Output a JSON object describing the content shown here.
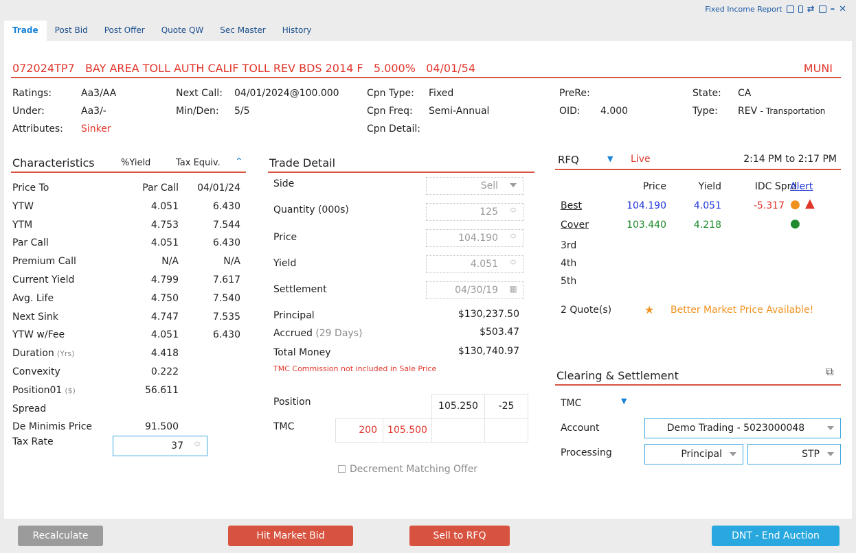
{
  "window": {
    "report_label": "Fixed Income Report",
    "tabs": [
      "Trade",
      "Post Bid",
      "Post Offer",
      "Quote QW",
      "Sec Master",
      "History"
    ]
  },
  "security": {
    "header": "072024TP7   BAY AREA TOLL AUTH CALIF TOLL REV BDS 2014 F   5.000%   04/01/54",
    "sector": "MUNI"
  },
  "info": {
    "ratings_label": "Ratings:",
    "ratings_value": "Aa3/AA",
    "under_label": "Under:",
    "under_value": "Aa3/-",
    "attributes_label": "Attributes:",
    "attributes_value": "Sinker",
    "next_call_label": "Next Call:",
    "next_call_value": "04/01/2024@100.000",
    "min_den_label": "Min/Den:",
    "min_den_value": "5/5",
    "cpn_type_label": "Cpn Type:",
    "cpn_type_value": "Fixed",
    "cpn_freq_label": "Cpn Freq:",
    "cpn_freq_value": "Semi-Annual",
    "cpn_detail_label": "Cpn Detail:",
    "prere_label": "PreRe:",
    "oid_label": "OID:",
    "oid_value": "4.000",
    "state_label": "State:",
    "state_value": "CA",
    "type_label": "Type:",
    "type_value": "REV",
    "type_detail": "- Transportation"
  },
  "characteristics": {
    "title": "Characteristics",
    "col_yield": "%Yield",
    "col_tax": "Tax Equiv.",
    "rows": [
      {
        "label": "Price To",
        "a": "Par Call",
        "b": "04/01/24"
      },
      {
        "label": "YTW",
        "a": "4.051",
        "b": "6.430"
      },
      {
        "label": "YTM",
        "a": "4.753",
        "b": "7.544"
      },
      {
        "label": "Par Call",
        "a": "4.051",
        "b": "6.430"
      },
      {
        "label": "Premium Call",
        "a": "N/A",
        "b": "N/A"
      },
      {
        "label": "Current Yield",
        "a": "4.799",
        "b": "7.617"
      },
      {
        "label": "Avg. Life",
        "a": "4.750",
        "b": "7.540"
      },
      {
        "label": "Next Sink",
        "a": "4.747",
        "b": "7.535"
      },
      {
        "label": "YTW w/Fee",
        "a": "4.051",
        "b": "6.430"
      },
      {
        "label": "Duration",
        "unit": "(Yrs)",
        "a": "4.418",
        "b": ""
      },
      {
        "label": "Convexity",
        "a": "0.222",
        "b": ""
      },
      {
        "label": "Position01",
        "unit": "($)",
        "a": "56.611",
        "b": ""
      },
      {
        "label": "Spread",
        "a": "",
        "b": ""
      },
      {
        "label": "De Minimis Price",
        "a": "91.500",
        "b": ""
      }
    ],
    "tax_rate_label": "Tax Rate",
    "tax_rate_value": "37"
  },
  "trade": {
    "title": "Trade Detail",
    "side_label": "Side",
    "side_value": "Sell",
    "qty_label": "Quantity (000s)",
    "qty_value": "125",
    "price_label": "Price",
    "price_value": "104.190",
    "yield_label": "Yield",
    "yield_value": "4.051",
    "settle_label": "Settlement",
    "settle_value": "04/30/19",
    "principal_label": "Principal",
    "principal_value": "$130,237.50",
    "accrued_label": "Accrued",
    "accrued_days": "(29 Days)",
    "accrued_value": "$503.47",
    "total_label": "Total Money",
    "total_value": "$130,740.97",
    "commission_note": "TMC Commission not included in Sale Price",
    "position_label": "Position",
    "position_price": "105.250",
    "position_qty": "-25",
    "tmc_label": "TMC",
    "tmc_qty": "200",
    "tmc_price": "105.500",
    "decrement_label": "Decrement Matching Offer"
  },
  "rfq": {
    "title": "RFQ",
    "status": "Live",
    "time_window": "2:14 PM to 2:17 PM",
    "headers": [
      "Price",
      "Yield",
      "IDC Sprd",
      "Alert"
    ],
    "rows": [
      {
        "label": "Best",
        "price": "104.190",
        "yield": "4.051",
        "sprd": "-5.317"
      },
      {
        "label": "Cover",
        "price": "103.440",
        "yield": "4.218",
        "sprd": ""
      },
      {
        "label": "3rd",
        "price": "",
        "yield": "",
        "sprd": ""
      },
      {
        "label": "4th",
        "price": "",
        "yield": "",
        "sprd": ""
      },
      {
        "label": "5th",
        "price": "",
        "yield": "",
        "sprd": ""
      }
    ],
    "quote_count": "2 Quote(s)",
    "better_price_msg": "Better Market Price Available!"
  },
  "clearing": {
    "title": "Clearing & Settlement",
    "firm": "TMC",
    "account_label": "Account",
    "account_value": "Demo Trading - 5023000048",
    "processing_label": "Processing",
    "processing_value": "Principal",
    "processing_mode": "STP"
  },
  "buttons": {
    "recalculate": "Recalculate",
    "hit_bid": "Hit Market Bid",
    "sell_rfq": "Sell to RFQ",
    "end_auction": "DNT - End Auction"
  },
  "colors": {
    "accent_red": "#d8533f",
    "link_blue": "#1a83d6",
    "end_auction_blue": "#29a8e0",
    "disabled_gray": "#9b9b9b"
  }
}
